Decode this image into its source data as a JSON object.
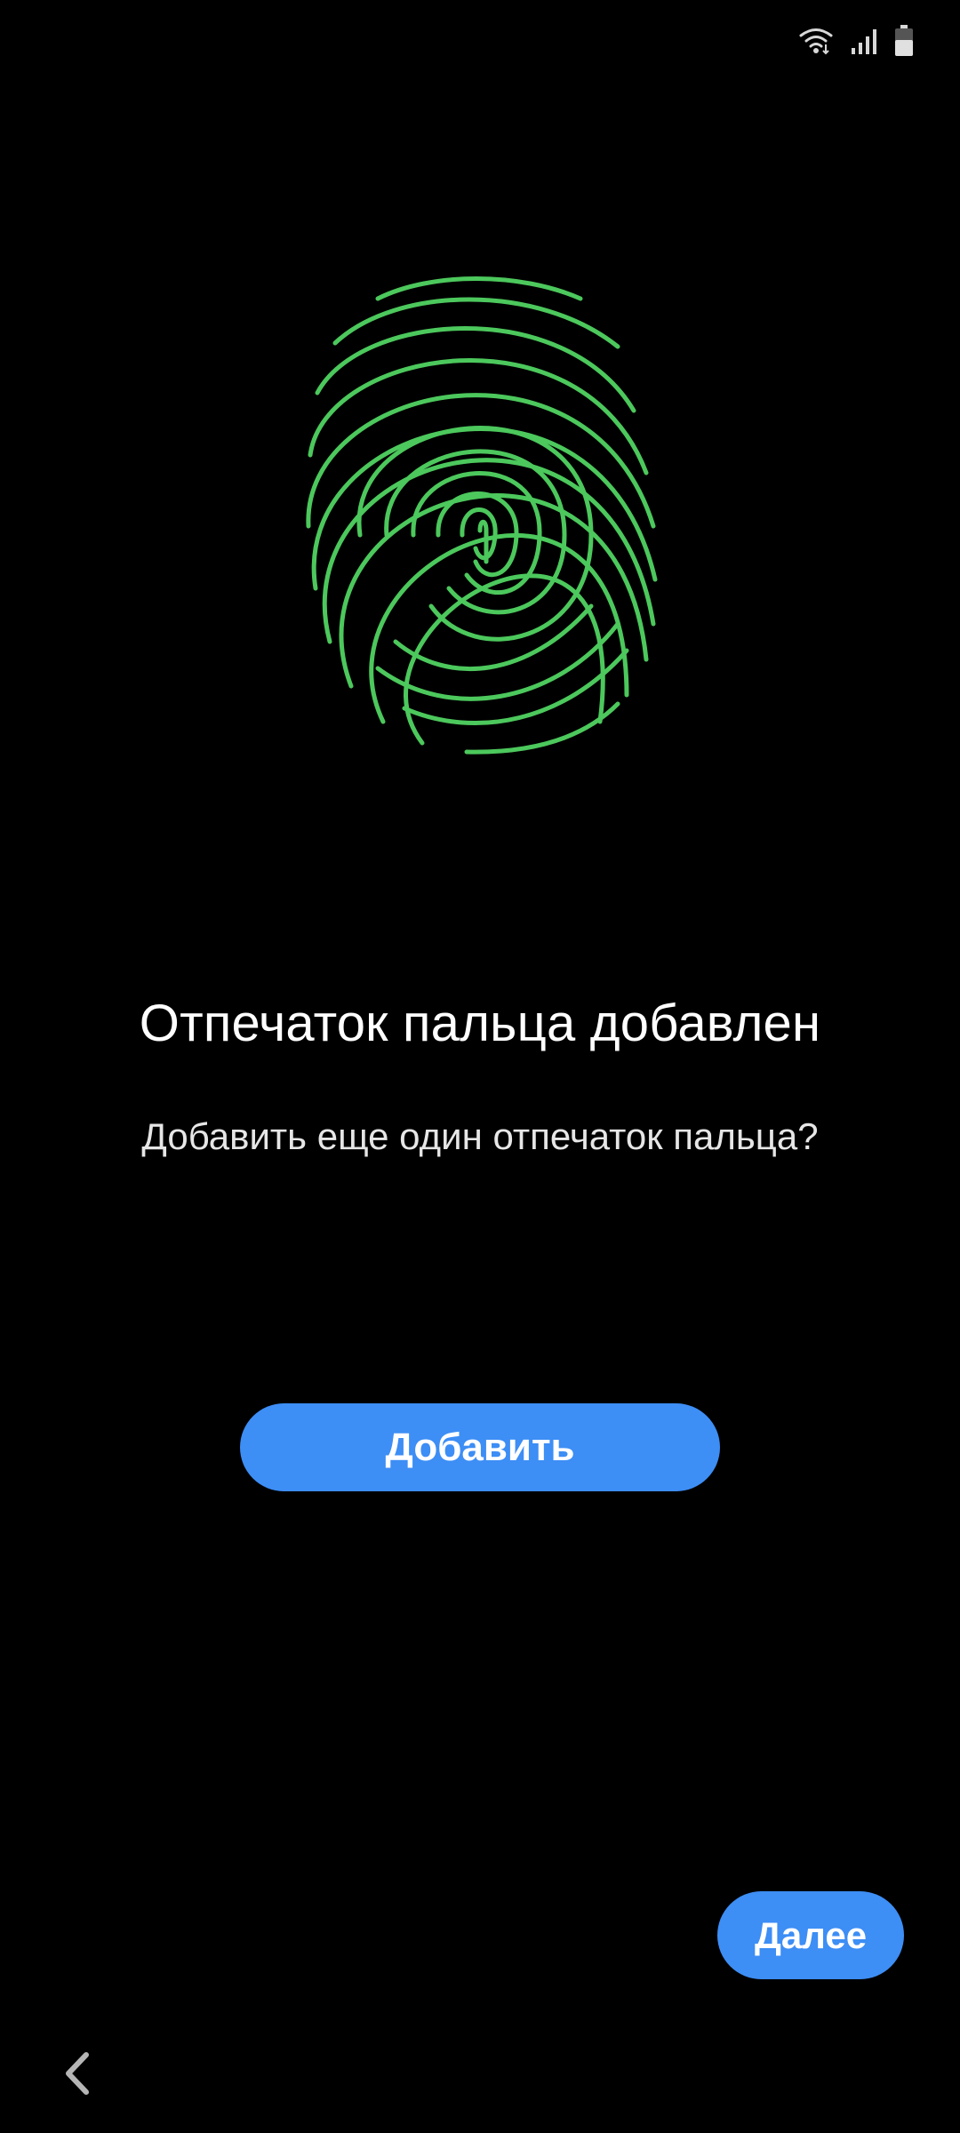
{
  "status_bar": {
    "icons": [
      "wifi-icon",
      "signal-icon",
      "battery-icon"
    ]
  },
  "fingerprint": {
    "icon": "fingerprint-icon",
    "color": "#4cc85c"
  },
  "main": {
    "title": "Отпечаток пальца добавлен",
    "subtitle": "Добавить еще один отпечаток пальца?"
  },
  "actions": {
    "add_label": "Добавить",
    "next_label": "Далее"
  },
  "navigation": {
    "back_icon": "chevron-left-icon"
  },
  "colors": {
    "background": "#000000",
    "accent": "#3d8ef5",
    "fingerprint": "#4cc85c"
  }
}
